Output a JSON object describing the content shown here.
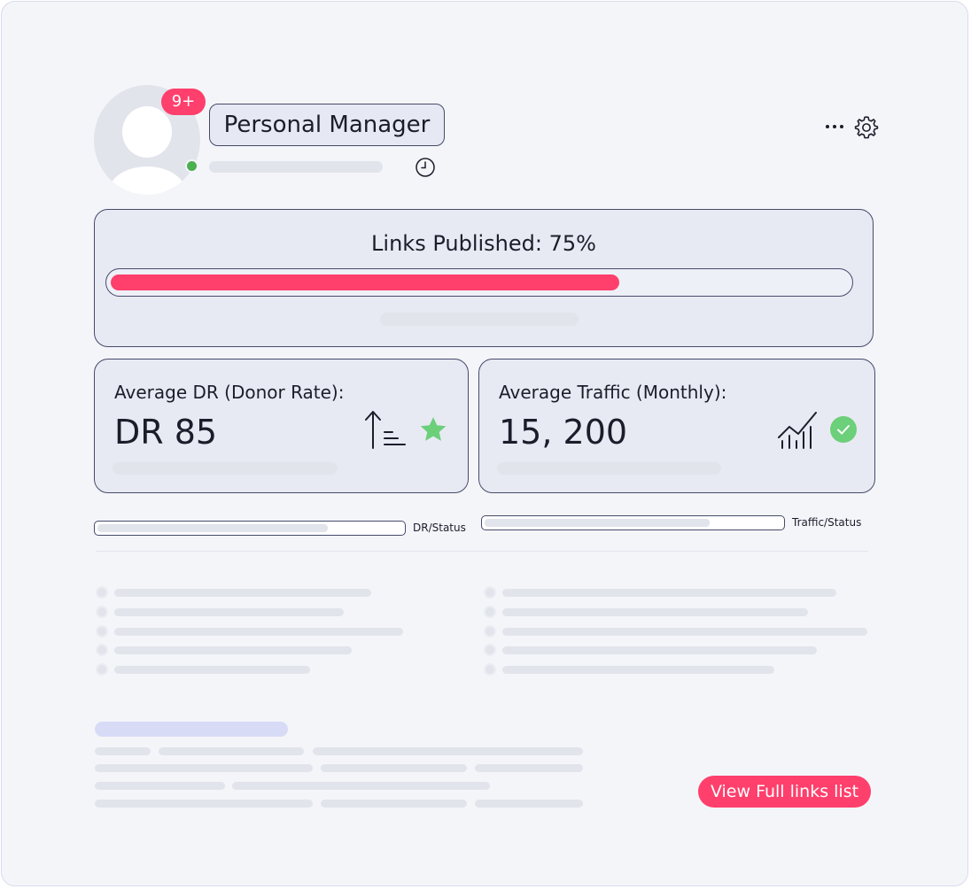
{
  "profile": {
    "title": "Personal Manager",
    "notification_badge": "9+",
    "online": true
  },
  "links_published": {
    "label": "Links Published: 75%",
    "progress_percent": 69
  },
  "metrics": {
    "dr": {
      "label": "Average DR (Donor Rate):",
      "value": "DR 85"
    },
    "traffic": {
      "label": "Average Traffic (Monthly):",
      "value": "15, 200"
    }
  },
  "status": {
    "dr_label": "DR/Status",
    "traffic_label": "Traffic/Status"
  },
  "actions": {
    "view_full_list": "View Full links list"
  },
  "icons": [
    "clock-icon",
    "more-dots-icon",
    "gear-icon",
    "sort-ascending-icon",
    "star-icon",
    "trending-chart-icon",
    "check-circle-icon"
  ],
  "colors": {
    "accent": "#ff3f6c",
    "online": "#4caf50",
    "success": "#6ccf7a",
    "placeholder": "#e2e4ec"
  }
}
